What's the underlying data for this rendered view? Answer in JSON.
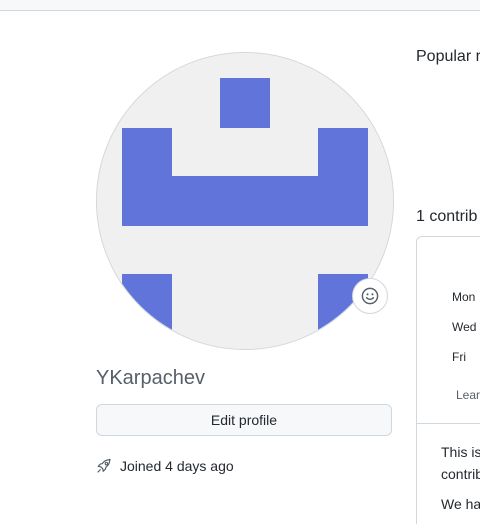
{
  "profile": {
    "username": "YKarpachev",
    "edit_label": "Edit profile",
    "joined_text": "Joined 4 days ago"
  },
  "main": {
    "popular_heading": "Popular r",
    "contrib_heading": "1 contrib",
    "days": [
      "Mon",
      "Wed",
      "Fri"
    ],
    "learn_link": "Lear",
    "info_line1": "This is",
    "info_line2": "contrib",
    "info_line3": "We ha"
  },
  "colors": {
    "identicon": "#6174d9",
    "avatar_bg": "#f0f0f0"
  },
  "icons": {
    "status": "smiley-icon",
    "joined": "rocket-icon"
  }
}
